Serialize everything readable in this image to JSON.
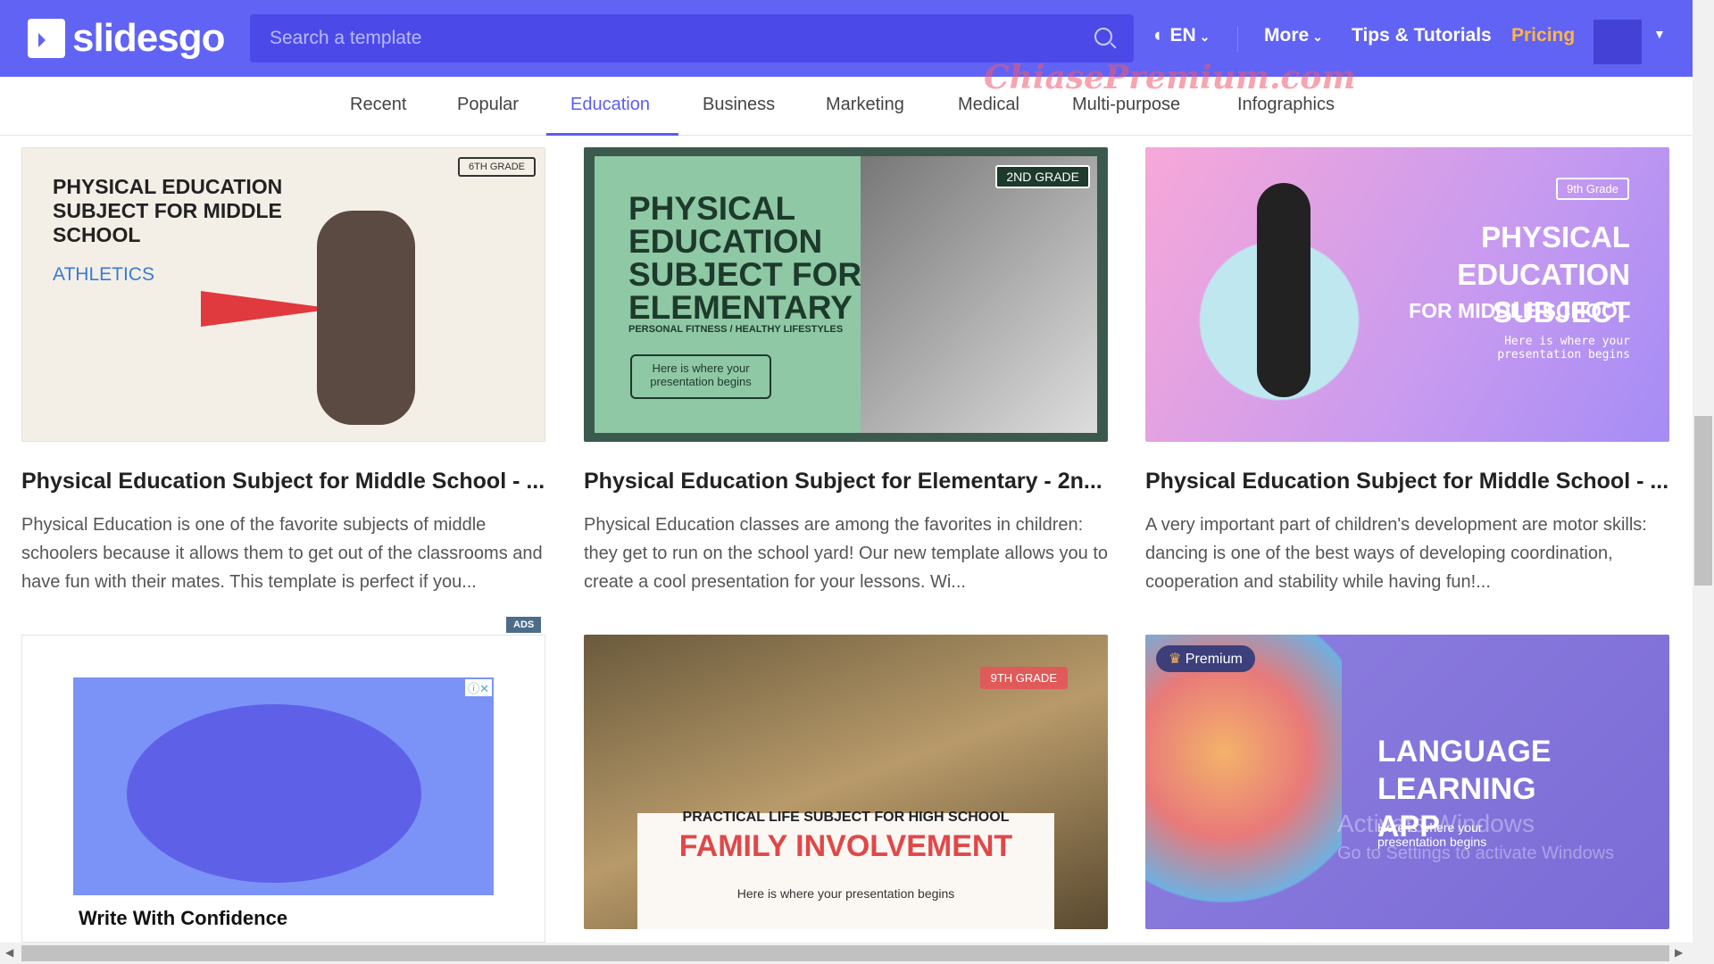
{
  "header": {
    "brand": "slidesgo",
    "search_placeholder": "Search a template",
    "language": "EN",
    "more": "More",
    "tips": "Tips & Tutorials",
    "pricing": "Pricing"
  },
  "tabs": [
    "Recent",
    "Popular",
    "Education",
    "Business",
    "Marketing",
    "Medical",
    "Multi-purpose",
    "Infographics"
  ],
  "active_tab": "Education",
  "watermark": "ChiasePremium.com",
  "cards": [
    {
      "title": "Physical Education Subject for Middle School - ...",
      "description": "Physical Education is one of the favorite subjects of middle schoolers because it allows them to get out of the classrooms and have fun with their mates. This template is perfect if you...",
      "thumb_title": "PHYSICAL EDUCATION SUBJECT FOR MIDDLE SCHOOL",
      "thumb_sub": "ATHLETICS",
      "thumb_badge": "6TH GRADE"
    },
    {
      "title": "Physical Education Subject for Elementary - 2n...",
      "description": "Physical Education classes are among the favorites in children: they get to run on the school yard! Our new template allows you to create a cool presentation for your lessons. Wi...",
      "thumb_title": "PHYSICAL EDUCATION SUBJECT FOR ELEMENTARY",
      "thumb_sub": "PERSONAL FITNESS / HEALTHY LIFESTYLES",
      "thumb_badge": "2ND GRADE",
      "thumb_button": "Here is where your presentation begins"
    },
    {
      "title": "Physical Education Subject for Middle School - ...",
      "description": "A very important part of children's development are motor skills: dancing is one of the best ways of developing coordination, cooperation and stability while having fun!...",
      "thumb_title": "PHYSICAL EDUCATION SUBJECT",
      "thumb_sub": "FOR MIDDLE SCHOOL",
      "thumb_badge": "9th Grade",
      "thumb_tagline": "Here is where your presentation begins"
    },
    {
      "thumb_title": "FAMILY INVOLVEMENT",
      "thumb_sub": "PRACTICAL LIFE SUBJECT FOR HIGH SCHOOL",
      "thumb_badge": "9TH GRADE",
      "thumb_tagline": "Here is where your presentation begins"
    },
    {
      "thumb_title": "LANGUAGE LEARNING APP",
      "thumb_tagline": "Here is where your presentation begins",
      "premium": "Premium",
      "overlay": "Activate Windows",
      "overlay_sub": "Go to Settings to activate Windows"
    }
  ],
  "ad": {
    "label": "ADS",
    "headline": "Write With Confidence"
  },
  "colors": {
    "brand": "#6163f5",
    "accent": "#5b5ef0",
    "pricing": "#ffb547"
  }
}
